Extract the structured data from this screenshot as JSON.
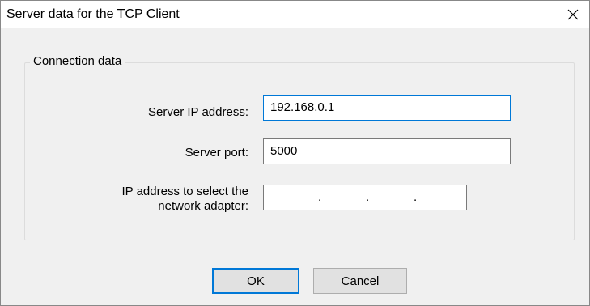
{
  "window": {
    "title": "Server data for the TCP Client",
    "close_glyph": "✕"
  },
  "group": {
    "legend": "Connection data"
  },
  "fields": {
    "server_ip": {
      "label": "Server IP address:",
      "value": "192.168.0.1"
    },
    "server_port": {
      "label": "Server port:",
      "value": "5000"
    },
    "adapter_ip": {
      "label": "IP address to select the network adapter:",
      "value": "",
      "separators": [
        ".",
        ".",
        "."
      ]
    }
  },
  "buttons": {
    "ok_label": "OK",
    "cancel_label": "Cancel"
  },
  "colors": {
    "focus_accent": "#0078d7",
    "dialog_background": "#f0f0f0",
    "button_face": "#e1e1e1"
  },
  "icons": {
    "close": "close-icon"
  }
}
